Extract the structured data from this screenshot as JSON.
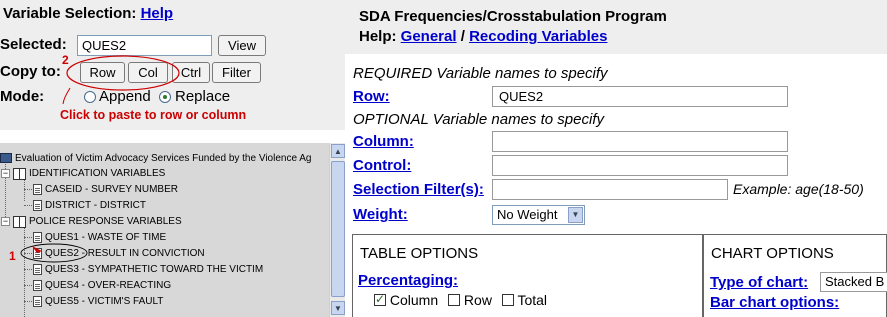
{
  "left": {
    "title": "Variable Selection:",
    "help_link": "Help",
    "selected_label": "Selected:",
    "selected_value": "QUES2",
    "view_button": "View",
    "copy_to_label": "Copy to:",
    "row_button": "Row",
    "col_button": "Col",
    "ctrl_button": "Ctrl",
    "filter_button": "Filter",
    "mode_label": "Mode:",
    "append_label": "Append",
    "replace_label": "Replace",
    "annotation_hint": "Click to paste to row or column",
    "annotation_num_1": "1",
    "annotation_num_2": "2",
    "tree": {
      "root": "Evaluation of Victim Advocacy Services Funded by the Violence Ag",
      "groups": [
        {
          "label": "IDENTIFICATION VARIABLES",
          "items": [
            "CASEID - SURVEY NUMBER",
            "DISTRICT - DISTRICT"
          ]
        },
        {
          "label": "POLICE RESPONSE VARIABLES",
          "items": [
            "QUES1 - WASTE OF TIME",
            "QUES2 - RESULT IN CONVICTION",
            "QUES3 - SYMPATHETIC TOWARD THE VICTIM",
            "QUES4 - OVER-REACTING",
            "QUES5 - VICTIM'S FAULT"
          ]
        }
      ]
    }
  },
  "right": {
    "title": "SDA Frequencies/Crosstabulation Program",
    "help_label": "Help:",
    "help_general": "General",
    "help_sep": "/",
    "help_recoding": "Recoding Variables",
    "required_heading": "REQUIRED Variable names to specify",
    "row_label": "Row:",
    "row_value": "QUES2",
    "optional_heading": "OPTIONAL Variable names to specify",
    "column_label": "Column:",
    "control_label": "Control:",
    "filter_label": "Selection Filter(s):",
    "filter_example": "Example: age(18-50)",
    "weight_label": "Weight:",
    "weight_value": "No Weight",
    "table_options_heading": "TABLE OPTIONS",
    "percentaging_label": "Percentaging:",
    "pct_column": "Column",
    "pct_row": "Row",
    "pct_total": "Total",
    "chart_options_heading": "CHART OPTIONS",
    "chart_type_label": "Type of chart:",
    "chart_type_value": "Stacked B",
    "bar_options_label": "Bar chart options:"
  },
  "colors": {
    "link": "#0000cc",
    "annotation": "#cc0000",
    "panel_bg": "#eeeeee"
  }
}
